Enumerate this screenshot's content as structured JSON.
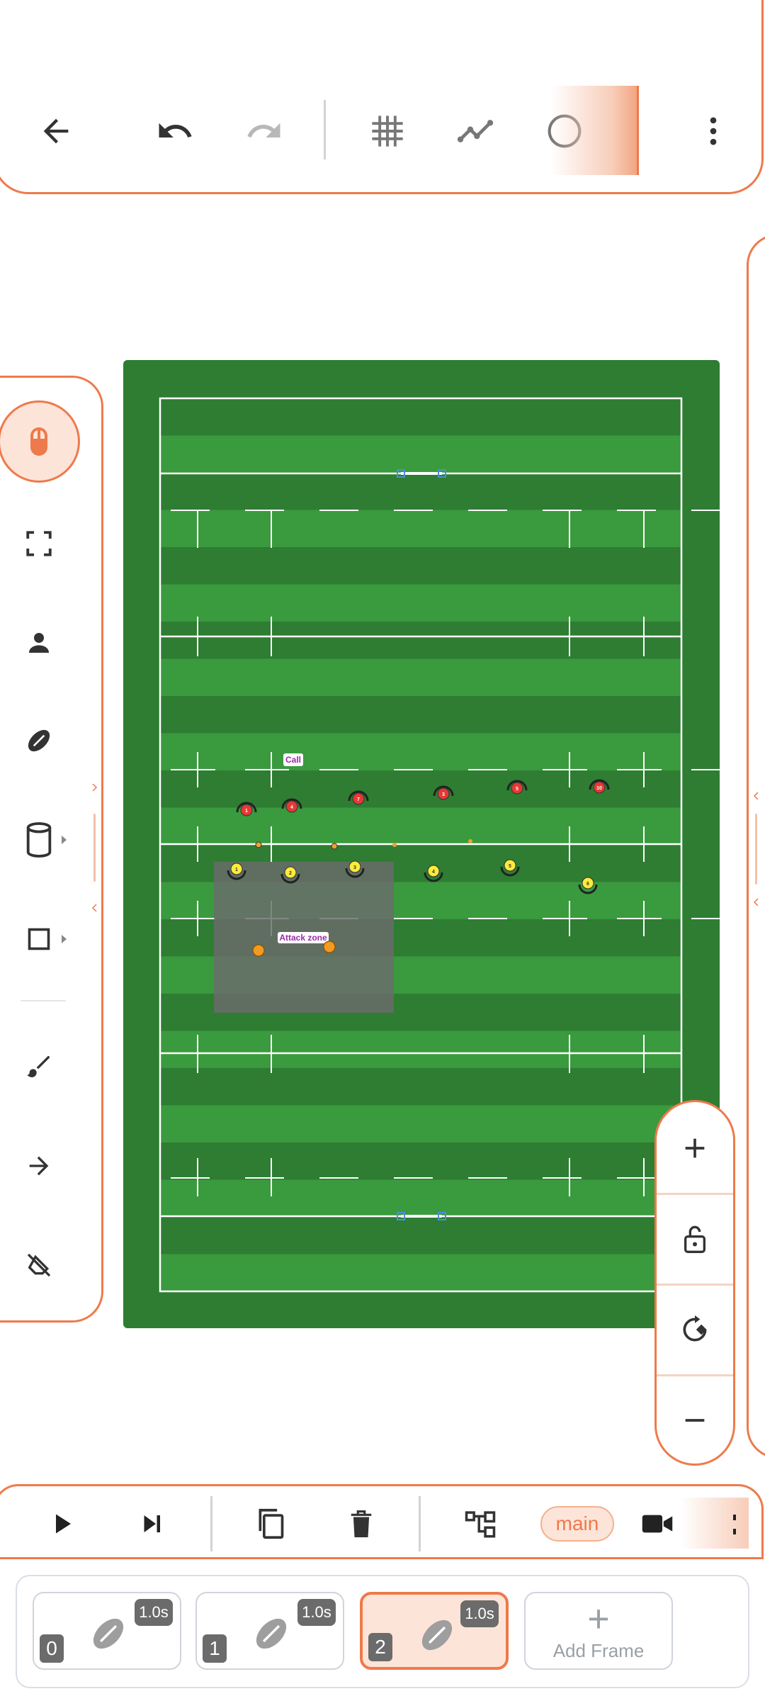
{
  "top_bar": {
    "icons": [
      "back-arrow-icon",
      "undo-icon",
      "redo-icon",
      "grid-icon",
      "polyline-icon",
      "circle-icon",
      "more-vert-icon"
    ]
  },
  "left_toolbar": {
    "tools": [
      "mouse-select-icon",
      "fullscreen-select-icon",
      "player-icon",
      "ball-icon",
      "cone-icon",
      "square-icon",
      "brush-icon",
      "arrow-right-icon",
      "eraser-icon"
    ],
    "active_tool": "mouse-select-icon"
  },
  "field": {
    "colors": {
      "dark_grass": "#2e7d32",
      "light_grass": "#3a9a3e",
      "lines": "#ffffff",
      "zone": "#6b6b6b"
    },
    "labels": {
      "call": "Call",
      "attack_zone": "Attack zone"
    },
    "red_players": [
      {
        "number": "1"
      },
      {
        "number": "4"
      },
      {
        "number": "7"
      },
      {
        "number": "3"
      },
      {
        "number": "5"
      },
      {
        "number": "10"
      }
    ],
    "yellow_players": [
      {
        "number": "1"
      },
      {
        "number": "2"
      },
      {
        "number": "3"
      },
      {
        "number": "4"
      },
      {
        "number": "5"
      },
      {
        "number": "6"
      }
    ]
  },
  "zoom_controls": {
    "icons": [
      "plus-icon",
      "lock-open-icon",
      "rotate-icon",
      "minus-icon"
    ]
  },
  "bottom_toolbar": {
    "icons": [
      "play-icon",
      "skip-next-icon",
      "copy-icon",
      "delete-icon",
      "tree-icon",
      "camera-icon"
    ],
    "branch_label": "main"
  },
  "frames": {
    "items": [
      {
        "index": "0",
        "duration": "1.0s",
        "selected": false
      },
      {
        "index": "1",
        "duration": "1.0s",
        "selected": false
      },
      {
        "index": "2",
        "duration": "1.0s",
        "selected": true
      }
    ],
    "add_label": "Add Frame",
    "add_symbol": "+"
  },
  "accent_color": "#ee7a4b"
}
